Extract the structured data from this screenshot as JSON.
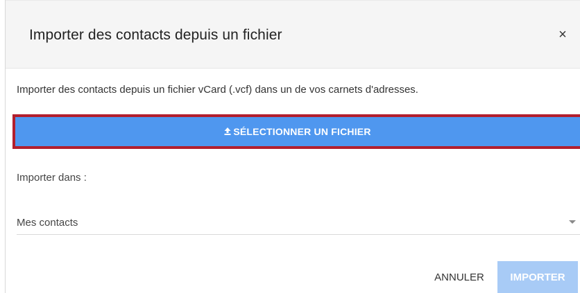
{
  "dialog": {
    "title": "Importer des contacts depuis un fichier",
    "close_label": "×",
    "description": "Importer des contacts depuis un fichier vCard (.vcf) dans un de vos carnets d'adresses.",
    "select_file_button": {
      "label": "SÉLECTIONNER UN FICHIER",
      "icon": "upload-icon"
    },
    "import_into": {
      "label": "Importer dans :",
      "selected_value": "Mes contacts"
    },
    "actions": {
      "cancel_label": "ANNULER",
      "import_label": "IMPORTER"
    }
  },
  "colors": {
    "primary_button": "#4f97ef",
    "disabled_button": "#a8cbf6",
    "highlight_border": "#b21f2d",
    "header_background": "#f5f5f5"
  }
}
